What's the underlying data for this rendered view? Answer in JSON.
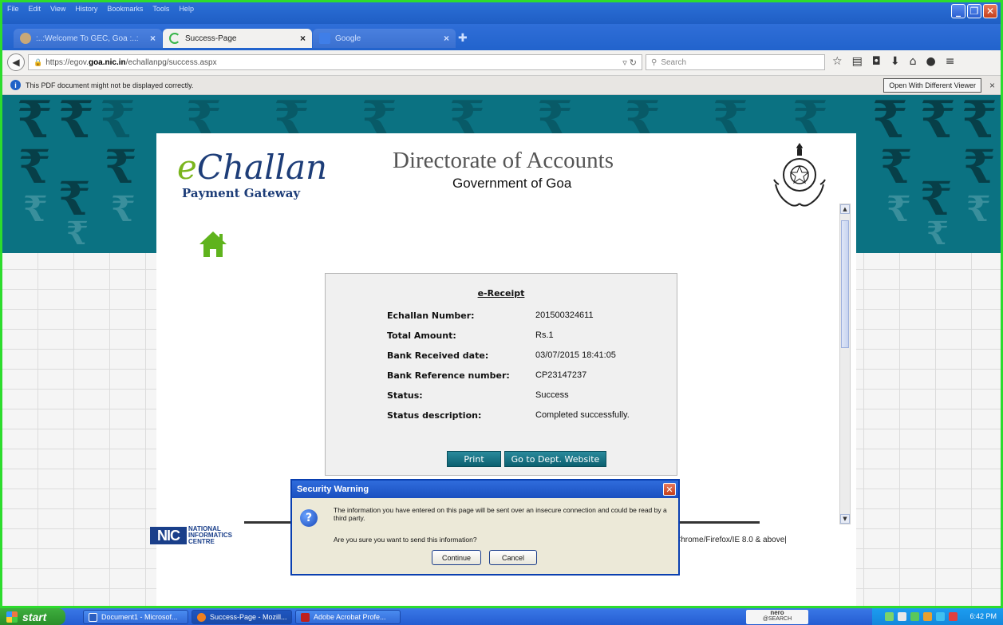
{
  "menubar": {
    "items": [
      "File",
      "Edit",
      "View",
      "History",
      "Bookmarks",
      "Tools",
      "Help"
    ]
  },
  "tabs": [
    {
      "label": ":..:Welcome To GEC, Goa :..:",
      "active": false
    },
    {
      "label": "Success-Page",
      "active": true
    },
    {
      "label": "Google",
      "active": false
    }
  ],
  "navbar": {
    "url_prefix": "https://egov.",
    "url_domain": "goa.nic.in",
    "url_suffix": "/echallanpg/success.aspx",
    "search_placeholder": "Search"
  },
  "notification": {
    "message": "This PDF document might not be displayed correctly.",
    "button_label": "Open With Different Viewer"
  },
  "header": {
    "logo_e": "e",
    "logo_rest": "Challan",
    "logo_subtitle": "Payment Gateway",
    "title": "Directorate of Accounts",
    "subtitle": "Government of Goa"
  },
  "receipt": {
    "title": "e-Receipt",
    "rows": [
      {
        "label": "Echallan Number:",
        "value": "201500324611"
      },
      {
        "label": "Total Amount:",
        "value": "Rs.1"
      },
      {
        "label": "Bank Received date:",
        "value": "03/07/2015 18:41:05"
      },
      {
        "label": "Bank Reference number:",
        "value": "CP23147237"
      },
      {
        "label": "Status:",
        "value": "Success"
      },
      {
        "label": "Status description:",
        "value": "Completed successfully."
      }
    ],
    "print_label": "Print",
    "dept_label": "Go to Dept. Website"
  },
  "footer": {
    "nic_logo": "NIC",
    "nic_line1": "NATIONAL",
    "nic_line2": "INFORMATICS",
    "nic_line3": "CENTRE",
    "browser_note": "Chrome/Firefox/IE 8.0 & above|"
  },
  "dialog": {
    "title": "Security Warning",
    "message": "The information you have entered on this page will be sent over an insecure connection and could be read by a third party.",
    "question": "Are you sure you want to send this information?",
    "continue_label": "Continue",
    "cancel_label": "Cancel"
  },
  "taskbar": {
    "start_label": "start",
    "tasks": [
      "Document1 - Microsof...",
      "Success-Page - Mozill...",
      "Adobe Acrobat Profe..."
    ],
    "nero_line1": "nero",
    "nero_line2": "@SEARCH",
    "clock": "6:42 PM"
  },
  "colors": {
    "banner": "#0b7282",
    "accent_green": "#7ab51d",
    "title_blue": "#1d3d78",
    "button_teal": "#0c6070",
    "window_border": "#2ddc2d"
  }
}
